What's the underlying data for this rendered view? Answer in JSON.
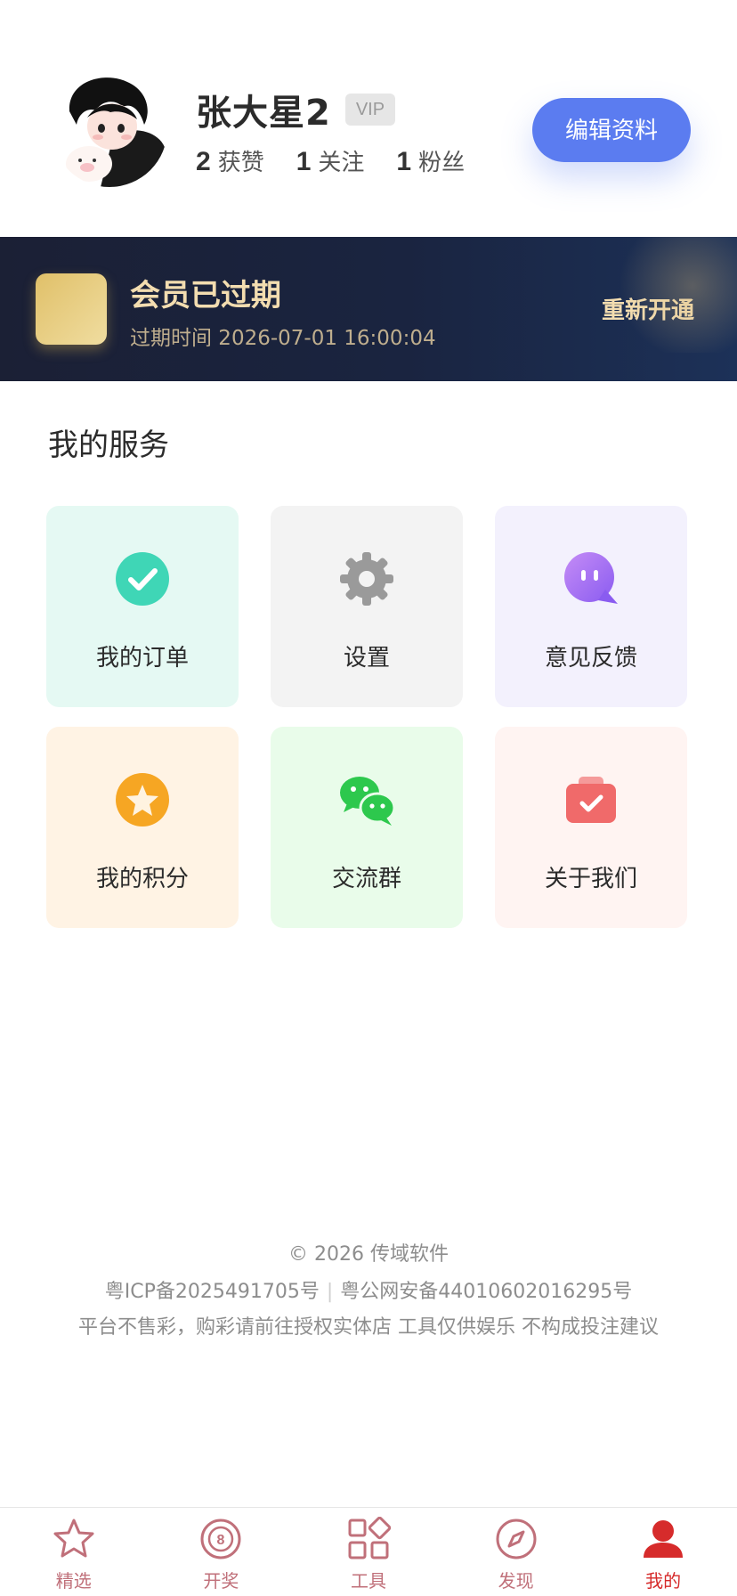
{
  "profile": {
    "username": "张大星2",
    "vip_badge": "VIP",
    "stats": [
      {
        "num": "2",
        "label": "获赞"
      },
      {
        "num": "1",
        "label": "关注"
      },
      {
        "num": "1",
        "label": "粉丝"
      }
    ],
    "edit_label": "编辑资料"
  },
  "membership": {
    "title": "会员已过期",
    "expire_text": "过期时间 2026-07-01 16:00:04",
    "renew_label": "重新开通",
    "accent": "#f3ddb0"
  },
  "services": {
    "title": "我的服务",
    "items": [
      {
        "label": "我的订单",
        "icon": "check-circle-icon",
        "color": "#3fd6b6"
      },
      {
        "label": "设置",
        "icon": "gear-icon",
        "color": "#9a9a9a"
      },
      {
        "label": "意见反馈",
        "icon": "chat-bubble-icon",
        "color": "#9b6df2"
      },
      {
        "label": "我的积分",
        "icon": "star-icon",
        "color": "#f6a623"
      },
      {
        "label": "交流群",
        "icon": "wechat-icon",
        "color": "#2dc84d"
      },
      {
        "label": "关于我们",
        "icon": "briefcase-check-icon",
        "color": "#f06a6a"
      }
    ]
  },
  "footer": {
    "copyright": "© 2026 传域软件",
    "icp": "粤ICP备2025491705号",
    "separator": "|",
    "police": "粤公网安备44010602016295号",
    "disclaimer": "平台不售彩，购彩请前往授权实体店 工具仅供娱乐 不构成投注建议"
  },
  "tabbar": {
    "items": [
      {
        "label": "精选",
        "icon": "star-outline-icon"
      },
      {
        "label": "开奖",
        "icon": "lottery-ball-icon"
      },
      {
        "label": "工具",
        "icon": "grid-icon"
      },
      {
        "label": "发现",
        "icon": "compass-icon"
      },
      {
        "label": "我的",
        "icon": "user-icon"
      }
    ],
    "active_index": 4,
    "active_color": "#d62b2b",
    "inactive_color": "#c0707a"
  }
}
